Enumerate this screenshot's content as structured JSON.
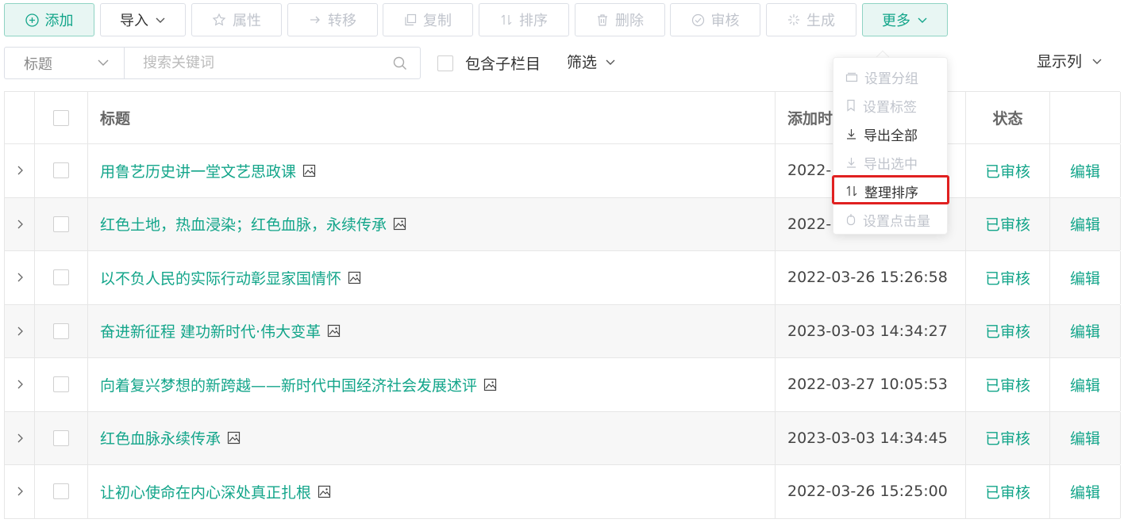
{
  "toolbar": {
    "add": "添加",
    "import": "导入",
    "attribute": "属性",
    "transfer": "转移",
    "copy": "复制",
    "sort": "排序",
    "delete": "删除",
    "review": "审核",
    "generate": "生成",
    "more": "更多"
  },
  "search": {
    "field": "标题",
    "placeholder": "搜索关键词",
    "include_sub": "包含子栏目",
    "filter": "筛选",
    "display_columns": "显示列"
  },
  "table": {
    "headers": {
      "title": "标题",
      "time": "添加时",
      "status": "状态"
    },
    "rows": [
      {
        "title": "用鲁艺历史讲一堂文艺思政课",
        "time": "2022-",
        "status": "已审核",
        "edit": "编辑"
      },
      {
        "title": "红色土地，热血浸染；红色血脉，永续传承",
        "time": "2022-",
        "status": "已审核",
        "edit": "编辑"
      },
      {
        "title": "以不负人民的实际行动彰显家国情怀",
        "time": "2022-03-26 15:26:58",
        "status": "已审核",
        "edit": "编辑"
      },
      {
        "title": "奋进新征程 建功新时代·伟大变革",
        "time": "2023-03-03 14:34:27",
        "status": "已审核",
        "edit": "编辑"
      },
      {
        "title": "向着复兴梦想的新跨越——新时代中国经济社会发展述评",
        "time": "2022-03-27 10:05:53",
        "status": "已审核",
        "edit": "编辑"
      },
      {
        "title": "红色血脉永续传承",
        "time": "2023-03-03 14:34:45",
        "status": "已审核",
        "edit": "编辑"
      },
      {
        "title": "让初心使命在内心深处真正扎根",
        "time": "2022-03-26 15:25:00",
        "status": "已审核",
        "edit": "编辑"
      }
    ]
  },
  "more_menu": {
    "items": [
      {
        "label": "设置分组",
        "icon": "folder-icon",
        "enabled": false
      },
      {
        "label": "设置标签",
        "icon": "bookmark-icon",
        "enabled": false
      },
      {
        "label": "导出全部",
        "icon": "download-icon",
        "enabled": true
      },
      {
        "label": "导出选中",
        "icon": "download-icon",
        "enabled": false
      },
      {
        "label": "整理排序",
        "icon": "sort-icon",
        "enabled": true
      },
      {
        "label": "设置点击量",
        "icon": "click-icon",
        "enabled": false
      }
    ]
  },
  "colors": {
    "accent": "#13a58a",
    "disabled": "#c0c4cc",
    "highlight_border": "#e02020"
  }
}
